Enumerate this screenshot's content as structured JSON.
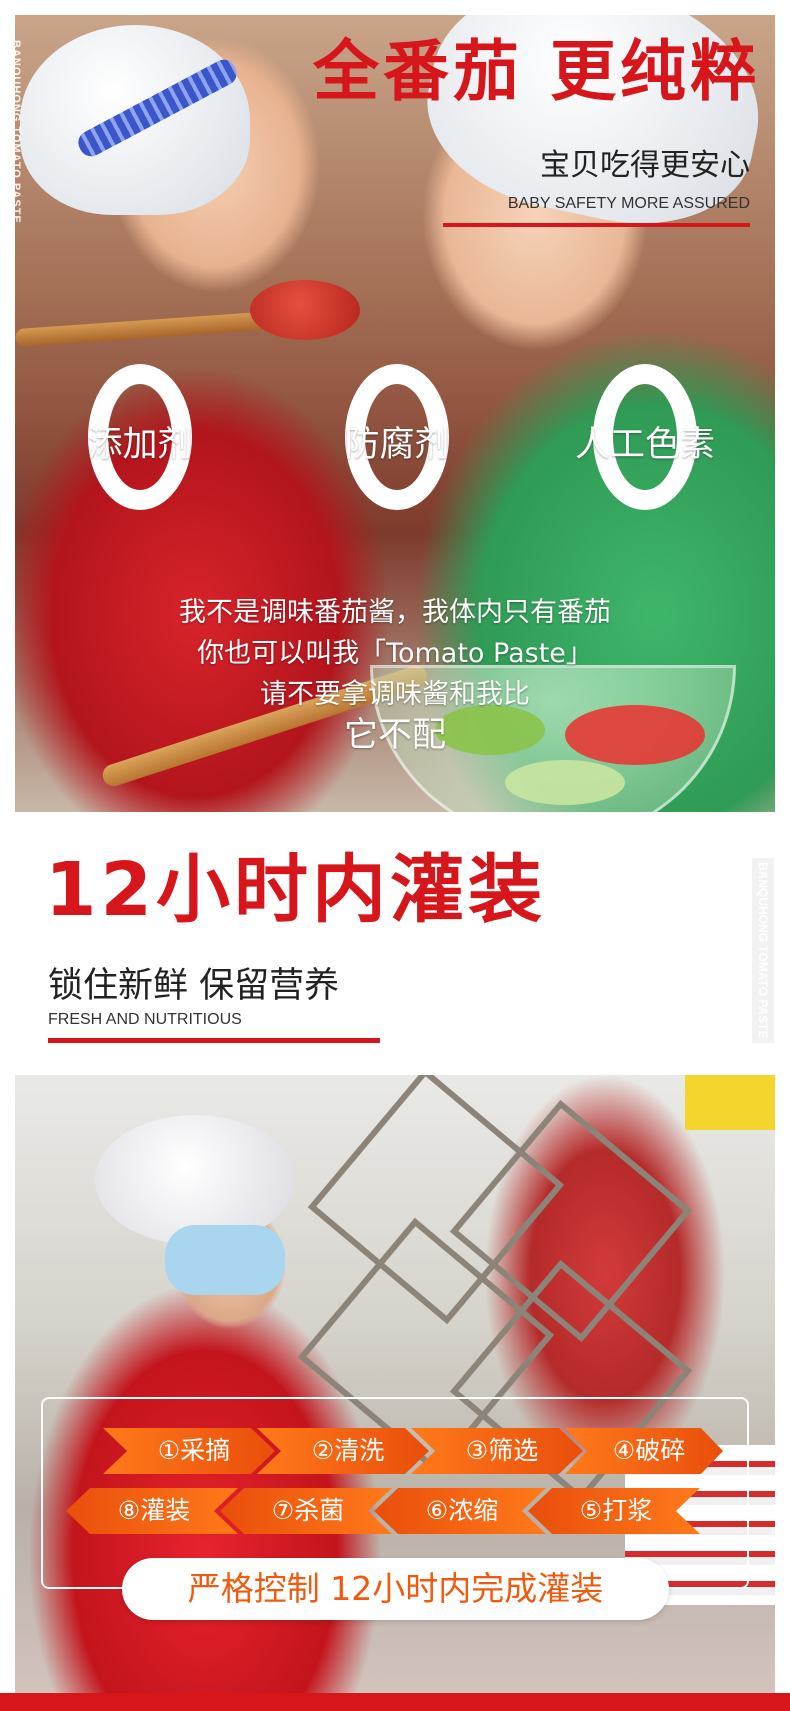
{
  "hero": {
    "side_text": "BANQUHONG TOMATO PASTE",
    "title": "全番茄 更纯粹",
    "subtitle": "宝贝吃得更安心",
    "subtitle_en": "BABY SAFETY MORE ASSURED",
    "zeros": [
      {
        "label": "添加剂"
      },
      {
        "label": "防腐剂"
      },
      {
        "label": "人工色素"
      }
    ],
    "slogan": [
      "我不是调味番茄酱，我体内只有番茄",
      "你也可以叫我「Tomato Paste」",
      "请不要拿调味酱和我比",
      "它不配"
    ]
  },
  "section2": {
    "title": "12小时内灌装",
    "subtitle": "锁住新鲜 保留营养",
    "subtitle_en": "FRESH AND NUTRITIOUS",
    "watermark": "BANQUHONG TOMATO PASTE"
  },
  "process": {
    "steps": [
      "①采摘",
      "②清洗",
      "③筛选",
      "④破碎",
      "⑤打浆",
      "⑥浓缩",
      "⑦杀菌",
      "⑧灌装"
    ],
    "banner": "严格控制 12小时内完成灌装"
  },
  "colors": {
    "brand_red": "#d7161c",
    "process_orange": "#ff7a1a",
    "banner_text": "#f15a0e"
  }
}
